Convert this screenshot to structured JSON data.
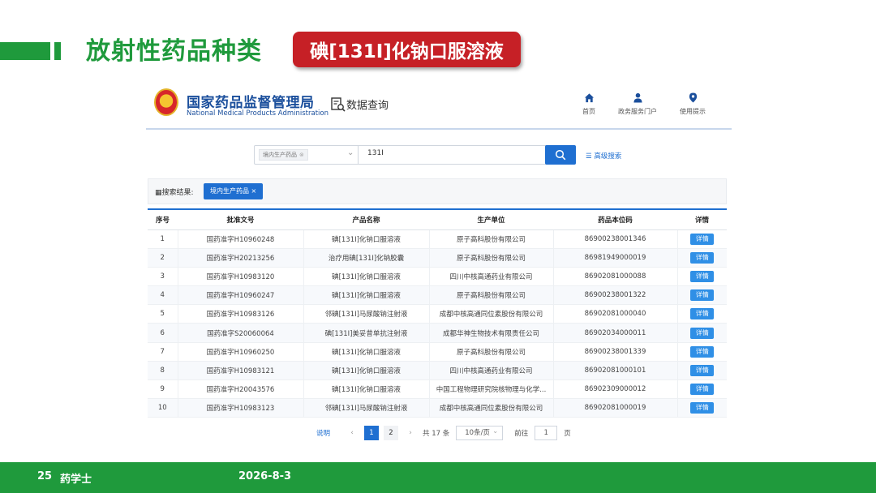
{
  "slide": {
    "title": "放射性药品种类",
    "label": "碘[131I]化钠口服溶液"
  },
  "site": {
    "org_cn": "国家药品监督管理局",
    "org_en": "National Medical Products Administration",
    "section": "数据查询",
    "nav": [
      "首页",
      "政务服务门户",
      "使用提示"
    ]
  },
  "search": {
    "category_tag": "境内生产药品",
    "query": "131I",
    "advanced": "高级搜索"
  },
  "results": {
    "label": "搜索结果:",
    "filter_chip": "境内生产药品"
  },
  "table": {
    "headers": [
      "序号",
      "批准文号",
      "产品名称",
      "生产单位",
      "药品本位码",
      "详情"
    ],
    "detail_label": "详情",
    "rows": [
      [
        "1",
        "国药准字H10960248",
        "碘[131I]化钠口服溶液",
        "原子高科股份有限公司",
        "86900238001346"
      ],
      [
        "2",
        "国药准字H20213256",
        "治疗用碘[131I]化钠胶囊",
        "原子高科股份有限公司",
        "86981949000019"
      ],
      [
        "3",
        "国药准字H10983120",
        "碘[131I]化钠口服溶液",
        "四川中核高通药业有限公司",
        "86902081000088"
      ],
      [
        "4",
        "国药准字H10960247",
        "碘[131I]化钠口服溶液",
        "原子高科股份有限公司",
        "86900238001322"
      ],
      [
        "5",
        "国药准字H10983126",
        "邻碘[131I]马尿酸钠注射液",
        "成都中核高通同位素股份有限公司",
        "86902081000040"
      ],
      [
        "6",
        "国药准字S20060064",
        "碘[131I]美妥昔单抗注射液",
        "成都华神生物技术有限责任公司",
        "86902034000011"
      ],
      [
        "7",
        "国药准字H10960250",
        "碘[131I]化钠口服溶液",
        "原子高科股份有限公司",
        "86900238001339"
      ],
      [
        "8",
        "国药准字H10983121",
        "碘[131I]化钠口服溶液",
        "四川中核高通药业有限公司",
        "86902081000101"
      ],
      [
        "9",
        "国药准字H20043576",
        "碘[131I]化钠口服溶液",
        "中国工程物理研究院核物理与化学...",
        "86902309000012"
      ],
      [
        "10",
        "国药准字H10983123",
        "邻碘[131I]马尿酸钠注射液",
        "成都中核高通同位素股份有限公司",
        "86902081000019"
      ]
    ]
  },
  "pager": {
    "help": "说明",
    "prev": "‹",
    "pages": [
      "1",
      "2"
    ],
    "next": "›",
    "total": "共 17 条",
    "page_size": "10条/页",
    "goto_label": "前往",
    "goto_value": "1",
    "goto_suffix": "页"
  },
  "footer": {
    "page_number": "25",
    "author": "药学士",
    "date": "2026-8-3"
  },
  "colors": {
    "brand_green": "#1f9a3c",
    "label_red": "#c62026",
    "site_blue": "#1f6fd1"
  }
}
